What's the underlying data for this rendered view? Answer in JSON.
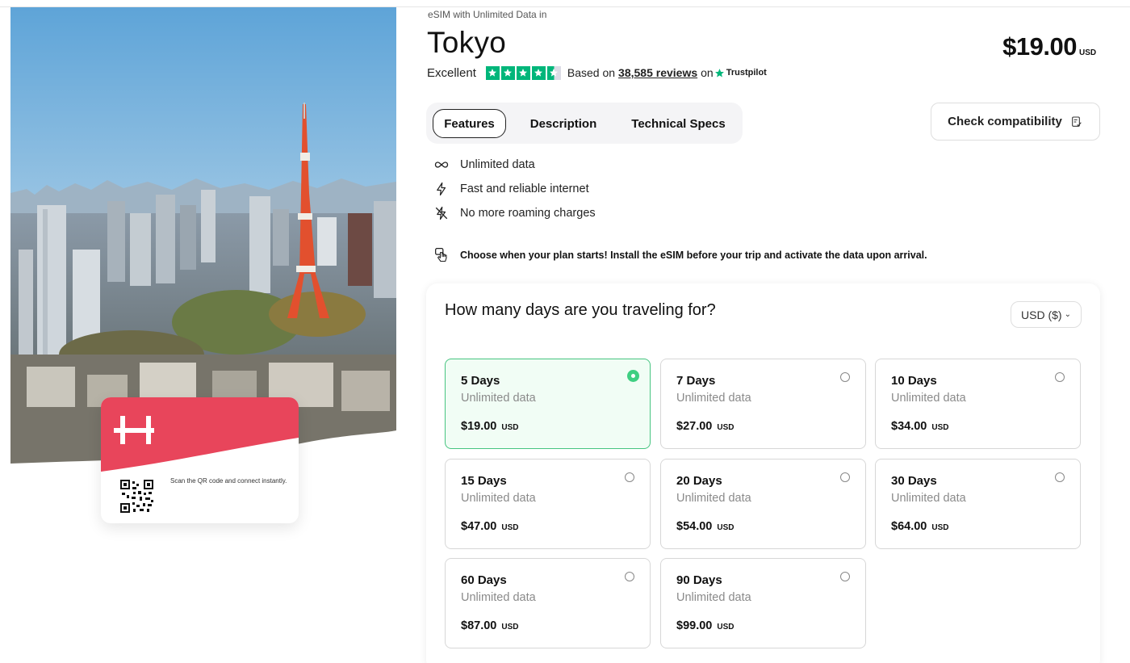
{
  "colors": {
    "accent_green": "#3fcf82",
    "trustpilot_green": "#00b67a",
    "brand_red": "#e8455b"
  },
  "product": {
    "eyebrow": "eSIM with Unlimited Data in",
    "title": "Tokyo",
    "price": "$19.00",
    "price_unit": "USD"
  },
  "rating": {
    "label": "Excellent",
    "stars": 4.5,
    "based_on": "Based on",
    "reviews": "38,585 reviews",
    "on": "on",
    "provider": "Trustpilot"
  },
  "tabs": [
    {
      "label": "Features",
      "active": true
    },
    {
      "label": "Description",
      "active": false
    },
    {
      "label": "Technical Specs",
      "active": false
    }
  ],
  "compat_button": {
    "label": "Check compatibility",
    "icon": "checklist-icon"
  },
  "features": [
    {
      "icon": "infinity-icon",
      "label": "Unlimited data"
    },
    {
      "icon": "lightning-icon",
      "label": "Fast and reliable internet"
    },
    {
      "icon": "no-roaming-icon",
      "label": "No more roaming charges"
    }
  ],
  "note": {
    "icon": "tap-hand-icon",
    "text": "Choose when your plan starts! Install the eSIM before your trip and activate the data upon arrival."
  },
  "card": {
    "text": "Scan the QR code and connect instantly."
  },
  "plans_panel": {
    "question": "How many days are you traveling for?",
    "currency": "USD ($)",
    "plans": [
      {
        "days": "5 Days",
        "data": "Unlimited data",
        "price": "$19.00",
        "cur": "USD",
        "selected": true
      },
      {
        "days": "7 Days",
        "data": "Unlimited data",
        "price": "$27.00",
        "cur": "USD",
        "selected": false
      },
      {
        "days": "10 Days",
        "data": "Unlimited data",
        "price": "$34.00",
        "cur": "USD",
        "selected": false
      },
      {
        "days": "15 Days",
        "data": "Unlimited data",
        "price": "$47.00",
        "cur": "USD",
        "selected": false
      },
      {
        "days": "20 Days",
        "data": "Unlimited data",
        "price": "$54.00",
        "cur": "USD",
        "selected": false
      },
      {
        "days": "30 Days",
        "data": "Unlimited data",
        "price": "$64.00",
        "cur": "USD",
        "selected": false
      },
      {
        "days": "60 Days",
        "data": "Unlimited data",
        "price": "$87.00",
        "cur": "USD",
        "selected": false
      },
      {
        "days": "90 Days",
        "data": "Unlimited data",
        "price": "$99.00",
        "cur": "USD",
        "selected": false
      }
    ]
  }
}
